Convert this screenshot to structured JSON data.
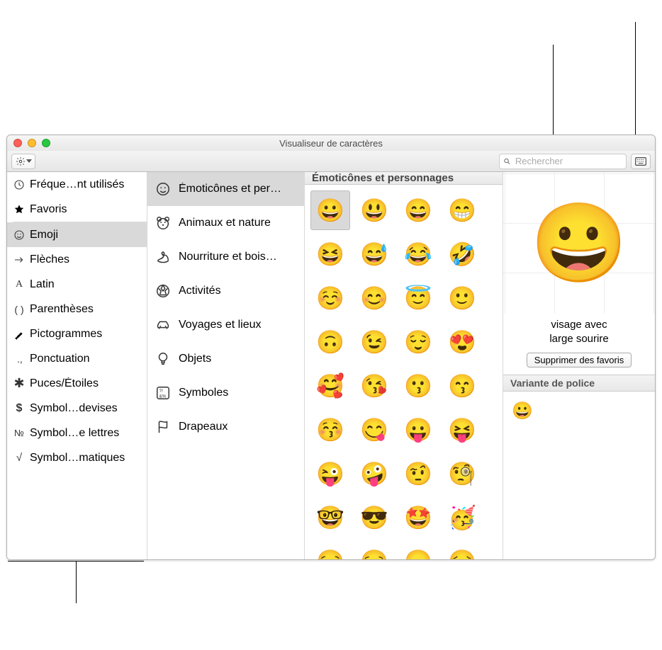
{
  "window": {
    "title": "Visualiseur de caractères"
  },
  "search": {
    "placeholder": "Rechercher"
  },
  "sidebar": {
    "items": [
      {
        "name": "recent",
        "label": "Fréque…nt utilisés",
        "icon": "clock-icon"
      },
      {
        "name": "favorites",
        "label": "Favoris",
        "icon": "star-icon"
      },
      {
        "name": "emoji",
        "label": "Emoji",
        "icon": "emoji-icon",
        "selected": true
      },
      {
        "name": "arrows",
        "label": "Flèches",
        "icon": "arrow-icon"
      },
      {
        "name": "latin",
        "label": "Latin",
        "icon": "latin-icon"
      },
      {
        "name": "parentheses",
        "label": "Parenthèses",
        "icon": "paren-icon"
      },
      {
        "name": "pictographs",
        "label": "Pictogrammes",
        "icon": "pen-icon"
      },
      {
        "name": "punctuation",
        "label": "Ponctuation",
        "icon": "dots-icon"
      },
      {
        "name": "bullets",
        "label": "Puces/Étoiles",
        "icon": "asterisk-icon"
      },
      {
        "name": "currency",
        "label": "Symbol…devises",
        "icon": "dollar-icon"
      },
      {
        "name": "letterlike",
        "label": "Symbol…e lettres",
        "icon": "numero-icon"
      },
      {
        "name": "math",
        "label": "Symbol…matiques",
        "icon": "sqrt-icon"
      }
    ]
  },
  "subcategories": {
    "items": [
      {
        "name": "smileys",
        "label": "Émoticônes et per…",
        "selected": true
      },
      {
        "name": "animals",
        "label": "Animaux et nature"
      },
      {
        "name": "food",
        "label": "Nourriture et bois…"
      },
      {
        "name": "activity",
        "label": "Activités"
      },
      {
        "name": "travel",
        "label": "Voyages et lieux"
      },
      {
        "name": "objects",
        "label": "Objets"
      },
      {
        "name": "symbols",
        "label": "Symboles"
      },
      {
        "name": "flags",
        "label": "Drapeaux"
      }
    ]
  },
  "grid": {
    "header": "Émoticônes et personnages",
    "cells": [
      "😀",
      "😃",
      "😄",
      "😁",
      "😆",
      "😅",
      "😂",
      "🤣",
      "☺️",
      "😊",
      "😇",
      "🙂",
      "🙃",
      "😉",
      "😌",
      "😍",
      "🥰",
      "😘",
      "😗",
      "😙",
      "😚",
      "😋",
      "😛",
      "😝",
      "😜",
      "🤪",
      "🤨",
      "🧐",
      "🤓",
      "😎",
      "🤩",
      "🥳",
      "😏",
      "😒",
      "😞",
      "😔"
    ],
    "selected_index": 0
  },
  "preview": {
    "glyph": "😀",
    "name_line1": "visage avec",
    "name_line2": "large sourire",
    "remove_btn": "Supprimer des favoris",
    "variants_header": "Variante de police",
    "variants": [
      "😀"
    ]
  }
}
